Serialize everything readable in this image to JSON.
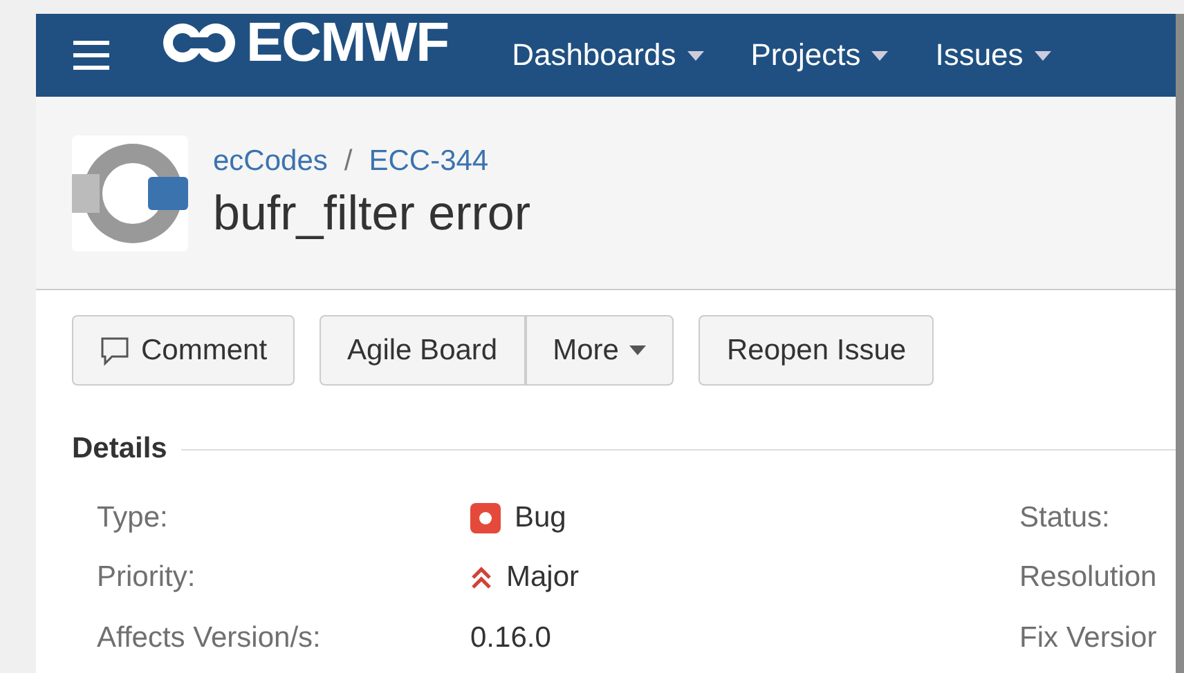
{
  "header": {
    "logo": "ECMWF",
    "nav": [
      "Dashboards",
      "Projects",
      "Issues"
    ]
  },
  "issue": {
    "breadcrumbs": [
      "ecCodes",
      "ECC-344"
    ],
    "separator": "/",
    "title": "bufr_filter error"
  },
  "toolbar": [
    {
      "label": "Comment",
      "kind": "comment"
    },
    {
      "label": "Agile Board",
      "kind": "group-start"
    },
    {
      "label": "More",
      "kind": "dropdown"
    },
    {
      "label": "Reopen Issue",
      "kind": "plain"
    }
  ],
  "details": {
    "heading": "Details",
    "rows": [
      {
        "label": "Type:",
        "value": "Bug",
        "kind": "type",
        "right_label": "Status:"
      },
      {
        "label": "Priority:",
        "value": "Major",
        "kind": "priority",
        "right_label": "Resolution"
      },
      {
        "label": "Affects Version/s:",
        "value": "0.16.0",
        "kind": "plain",
        "right_label": "Fix Versior"
      }
    ]
  }
}
